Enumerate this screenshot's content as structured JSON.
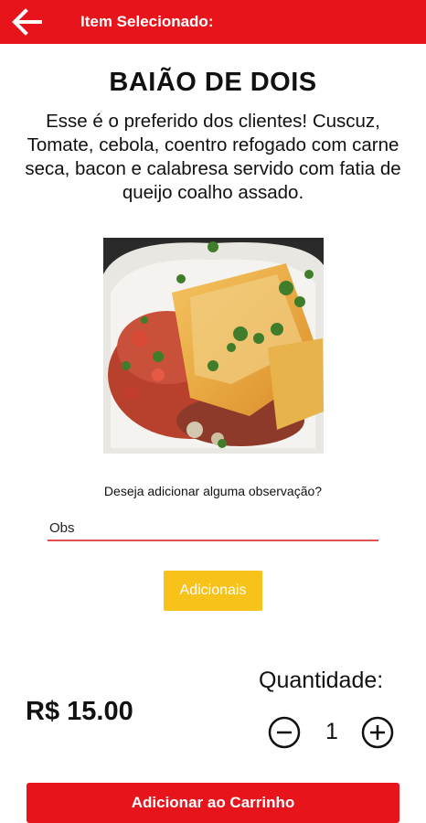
{
  "header": {
    "title": "Item Selecionado:",
    "back_icon": "arrow-left-icon",
    "background": "#e8141c"
  },
  "item": {
    "name": "BAIÃO DE DOIS",
    "description": "Esse é o preferido dos clientes! Cuscuz, Tomate, cebola, coentro refogado com carne seca, bacon e calabresa servido com fatia de queijo coalho assado."
  },
  "observation": {
    "question": "Deseja adicionar alguma observação?",
    "placeholder": "Obs",
    "value": ""
  },
  "addons": {
    "label": "Adicionais",
    "color": "#f7c21a"
  },
  "price": {
    "text": "R$ 15.00"
  },
  "quantity": {
    "label": "Quantidade:",
    "value": "1",
    "minus_icon": "minus-circle-icon",
    "plus_icon": "plus-circle-icon"
  },
  "cart": {
    "label": "Adicionar ao Carrinho",
    "color": "#e8141c"
  }
}
